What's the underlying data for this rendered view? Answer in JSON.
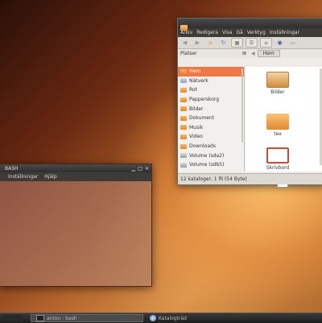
{
  "file_manager": {
    "menu": [
      "Arkiv",
      "Redigera",
      "Visa",
      "Gå",
      "Verktyg",
      "Inställningar"
    ],
    "places_label": "Platser",
    "breadcrumb": "Hem",
    "places": [
      {
        "label": "Hem",
        "selected": true
      },
      {
        "label": "Nätverk"
      },
      {
        "label": "Rot"
      },
      {
        "label": "Papperskorg"
      },
      {
        "label": "Bilder"
      },
      {
        "label": "Dokument"
      },
      {
        "label": "Musik"
      },
      {
        "label": "Video"
      },
      {
        "label": "Downloads"
      },
      {
        "label": "Volume (sda2)"
      },
      {
        "label": "Volume (sdb5)"
      }
    ],
    "files": [
      {
        "label": "Bilder",
        "icon": "pictures-folder-icon"
      },
      {
        "label": "tex",
        "icon": "folder-icon"
      },
      {
        "label": "Skrivbord",
        "icon": "desktop-folder-icon"
      },
      {
        "label": "",
        "icon": "file-icon"
      }
    ],
    "status": "12 kataloger, 1 fil (54 Byte)"
  },
  "terminal": {
    "title": "BASH",
    "menu": [
      "",
      "Inställningar",
      "Hjälp"
    ]
  },
  "panel": {
    "tasks": [
      "anton : bash",
      "Katalogträd"
    ]
  },
  "colors": {
    "selection": "#f07746",
    "folder": "#f6a54f"
  }
}
